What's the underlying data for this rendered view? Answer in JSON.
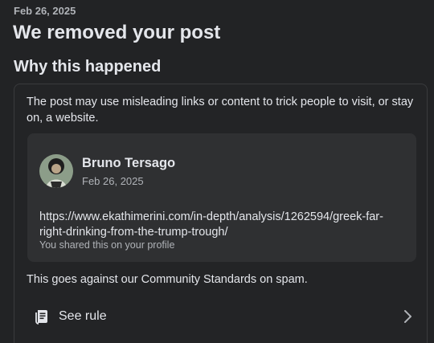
{
  "header": {
    "date": "Feb 26, 2025",
    "title": "We removed your post",
    "subtitle": "Why this happened"
  },
  "card": {
    "reason": "The post may use misleading links or content to trick people to visit, or stay on, a website.",
    "post": {
      "author": "Bruno Tersago",
      "date": "Feb 26, 2025",
      "link": "https://www.ekathimerini.com/in-depth/analysis/1262594/greek-far-right-drinking-from-the-trump-trough/",
      "shared_note": "You shared this on your profile"
    },
    "standard": "This goes against our Community Standards on spam.",
    "see_rule_label": "See rule"
  },
  "icons": {
    "rule": "rule-book-icon",
    "chevron": "chevron-right-icon",
    "avatar": "profile-photo"
  },
  "colors": {
    "background": "#222325",
    "card_border": "#3a3b3d",
    "post_background": "#2f3032",
    "primary_text": "#e4e6eb",
    "secondary_text": "#b0b3b8"
  }
}
